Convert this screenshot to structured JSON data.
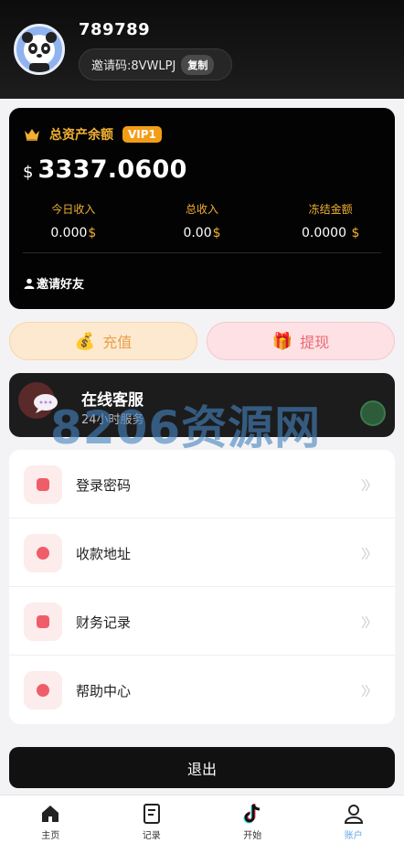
{
  "header": {
    "username": "789789",
    "invite_code_label": "邀请码:8VWLPJ",
    "copy_label": "复制"
  },
  "asset": {
    "title": "总资产余额",
    "vip": "VIP1",
    "currency": "$",
    "balance": "3337.0600",
    "stats": [
      {
        "label": "今日收入",
        "value": "0.000",
        "unit": "$"
      },
      {
        "label": "总收入",
        "value": "0.00",
        "unit": "$"
      },
      {
        "label": "冻结金额",
        "value": "0.0000",
        "unit": " $"
      }
    ],
    "invite_friends": "邀请好友"
  },
  "actions": {
    "recharge": "充值",
    "withdraw": "提现"
  },
  "service": {
    "title": "在线客服",
    "subtitle": "24小时服务"
  },
  "watermark": "8206资源网",
  "menu": [
    {
      "label": "登录密码",
      "icon": "lock-icon"
    },
    {
      "label": "收款地址",
      "icon": "address-icon"
    },
    {
      "label": "财务记录",
      "icon": "record-icon"
    },
    {
      "label": "帮助中心",
      "icon": "help-icon"
    }
  ],
  "menu_arrow": "〉〉",
  "logout": "退出",
  "tabs": [
    {
      "label": "主页",
      "icon": "home-icon"
    },
    {
      "label": "记录",
      "icon": "document-icon"
    },
    {
      "label": "开始",
      "icon": "tiktok-icon"
    },
    {
      "label": "账户",
      "icon": "user-icon",
      "active": true
    }
  ],
  "colors": {
    "gold": "#f0b032",
    "vip_badge": "#f39d17",
    "accent_red": "#f05d6a",
    "tab_active": "#6aa8e8"
  }
}
